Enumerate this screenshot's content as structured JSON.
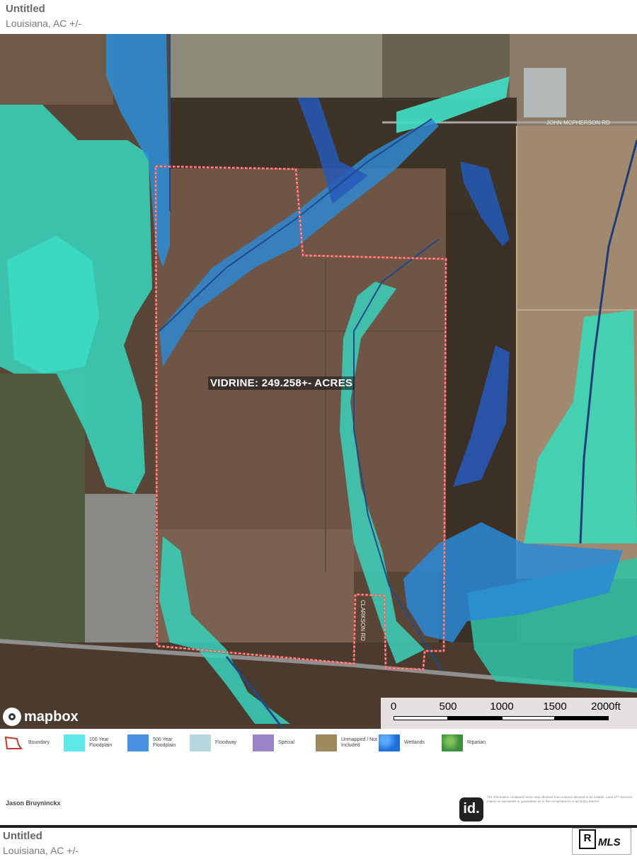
{
  "header": {
    "title": "Untitled",
    "subtitle": "Louisiana,  AC +/-"
  },
  "map": {
    "parcel_label": "VIDRINE: 249.258+- ACRES",
    "road_label_top": "JOHN MCPHERSON RD",
    "road_label_vertical": "CLARKSON RD",
    "attribution": "mapbox",
    "scale_labels": [
      "0",
      "500",
      "1000",
      "1500",
      "2000ft"
    ],
    "colors": {
      "boundary": "#ff5a5a",
      "floodplain_100": "#37e0c4",
      "floodplain_500": "#1d8fe0",
      "floodway": "#b7dfe6",
      "special": "#9a7fc0",
      "unmapped": "#a08a55",
      "wetlands": "#1f6fd8",
      "riparian": "#3f8f3a"
    }
  },
  "legend": [
    {
      "label": "Boundary",
      "icon": "boundary-outline-icon",
      "color": "#c0392b"
    },
    {
      "label": "100 Year\nFloodplain",
      "icon": "floodplain-100-swatch",
      "color": "#5fe8e8"
    },
    {
      "label": "500 Year\nFloodplain",
      "icon": "floodplain-500-swatch",
      "color": "#4a90e2"
    },
    {
      "label": "Floodway",
      "icon": "floodway-swatch",
      "color": "#b8d8e0"
    },
    {
      "label": "Special",
      "icon": "special-swatch",
      "color": "#9b84c7"
    },
    {
      "label": "Unmapped / Not\nIncluded",
      "icon": "unmapped-swatch",
      "color": "#9c8a5a"
    },
    {
      "label": "Wetlands",
      "icon": "wetlands-swatch",
      "color": "#1f6fd8"
    },
    {
      "label": "Riparian",
      "icon": "riparian-swatch",
      "color": "#3e8e3e"
    }
  ],
  "agent": {
    "name": "Jason Bruyninckx"
  },
  "branding": {
    "id_logo": "id.",
    "disclaimer": "The information contained herein was obtained from sources deemed to be reliable. Land id™ Services makes no warranties or guarantees as to the completeness or accuracy thereof.",
    "realtor_mark": "R",
    "mls_mark": "MLS"
  },
  "footer": {
    "title": "Untitled",
    "subtitle": "Louisiana,  AC +/-"
  }
}
